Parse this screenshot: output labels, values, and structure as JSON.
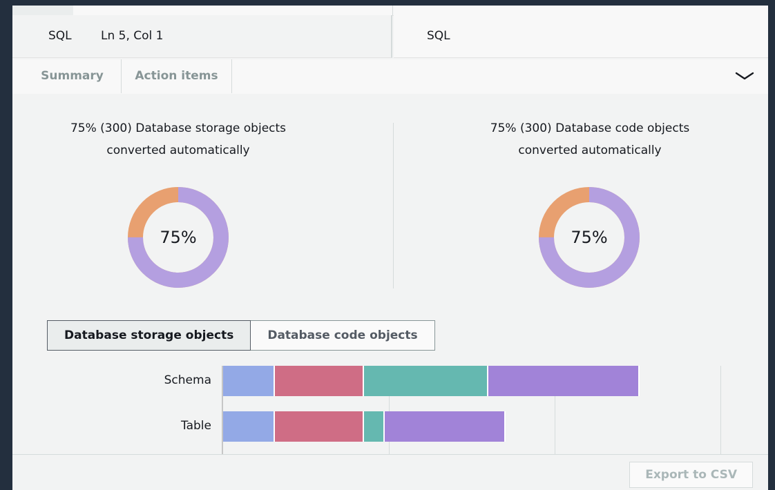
{
  "status": {
    "language_left": "SQL",
    "cursor_position": "Ln 5, Col 1",
    "language_right": "SQL"
  },
  "tabs": [
    {
      "label": "Summary"
    },
    {
      "label": "Action items"
    }
  ],
  "icons": {
    "collapse": "chevron-down-icon"
  },
  "storage_summary": {
    "line1": "75% (300) Database storage objects",
    "line2": "converted automatically",
    "percent_label": "75%",
    "converted_fraction": 0.75
  },
  "code_summary": {
    "line1": "75% (300) Database code objects",
    "line2": "converted automatically",
    "percent_label": "75%",
    "converted_fraction": 0.75
  },
  "colors": {
    "converted": "#b49fe0",
    "not_converted": "#e8a070",
    "bar_segments": [
      "#93a9e6",
      "#cf6d85",
      "#65b8b0",
      "#a183d8"
    ]
  },
  "object_toggle": {
    "storage_label": "Database storage objects",
    "code_label": "Database code objects",
    "selected": "storage"
  },
  "chart_data": {
    "type": "bar",
    "orientation": "horizontal",
    "stacked": true,
    "categories": [
      "Schema",
      "Table"
    ],
    "series": [
      {
        "values": [
          75,
          75
        ]
      },
      {
        "values": [
          129,
          129
        ]
      },
      {
        "values": [
          180,
          30
        ]
      },
      {
        "values": [
          219,
          175
        ]
      }
    ],
    "xlim": [
      0,
      720
    ],
    "grid": true
  },
  "footer": {
    "export_label": "Export to CSV"
  }
}
